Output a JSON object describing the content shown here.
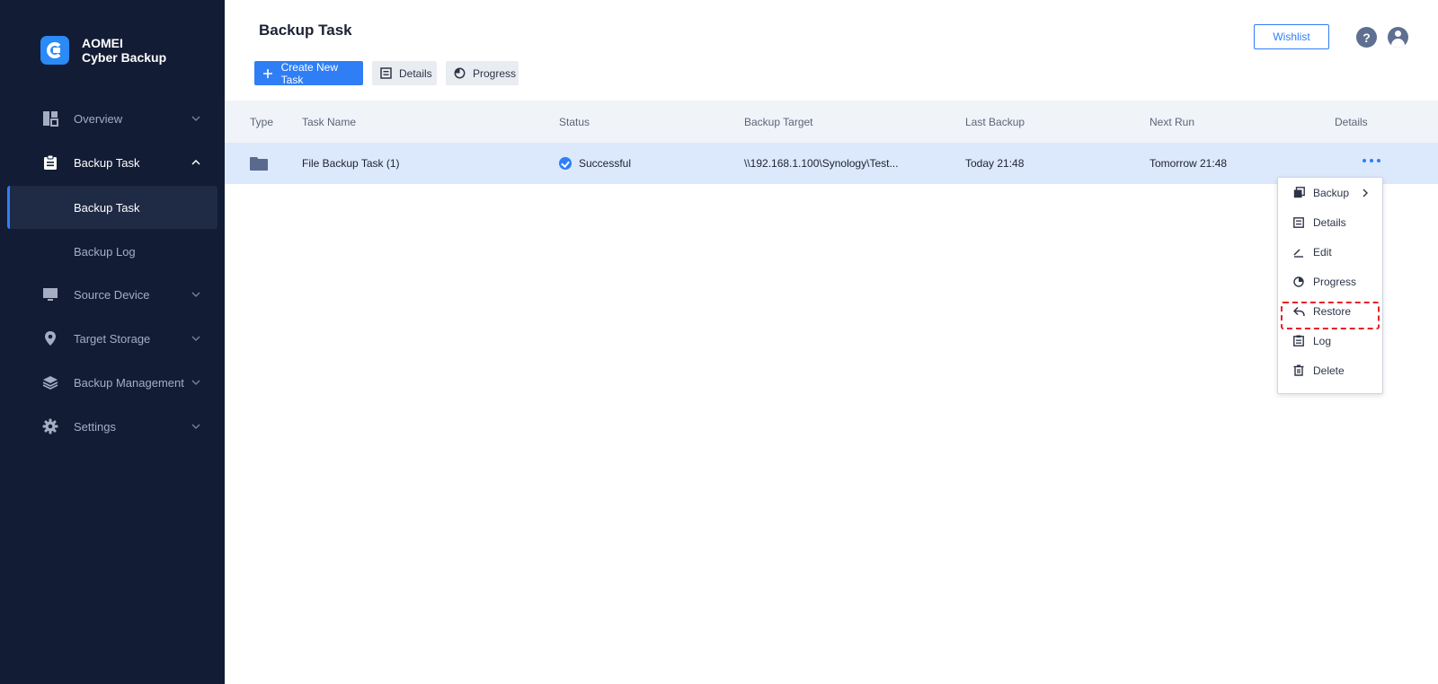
{
  "brand": {
    "line1": "AOMEI",
    "line2": "Cyber Backup",
    "accent": "#2f7ef5",
    "sidebar_bg": "#131c35"
  },
  "sidebar": {
    "items": [
      {
        "label": "Overview",
        "icon": "dashboard-icon"
      },
      {
        "label": "Backup Task",
        "icon": "clipboard-icon"
      },
      {
        "label": "Source Device",
        "icon": "monitor-icon"
      },
      {
        "label": "Target Storage",
        "icon": "location-pin-icon"
      },
      {
        "label": "Backup Management",
        "icon": "layers-icon"
      },
      {
        "label": "Settings",
        "icon": "gear-icon"
      }
    ],
    "subitems": [
      {
        "label": "Backup Task"
      },
      {
        "label": "Backup Log"
      }
    ]
  },
  "header": {
    "title": "Backup Task",
    "wishlist_label": "Wishlist",
    "help_label": "?"
  },
  "toolbar": {
    "create_label": "Create New Task",
    "details_label": "Details",
    "progress_label": "Progress"
  },
  "table": {
    "columns": [
      "Type",
      "Task Name",
      "Status",
      "Backup Target",
      "Last Backup",
      "Next Run",
      "Details"
    ],
    "rows": [
      {
        "type_icon": "folder-icon",
        "task_name": "File Backup Task (1)",
        "status": "Successful",
        "backup_target": "\\\\192.168.1.100\\Synology\\Test...",
        "last_backup": "Today 21:48",
        "next_run": "Tomorrow 21:48"
      }
    ]
  },
  "context_menu": {
    "items": [
      {
        "label": "Backup",
        "icon": "copy-icon"
      },
      {
        "label": "Details",
        "icon": "details-icon"
      },
      {
        "label": "Edit",
        "icon": "edit-icon"
      },
      {
        "label": "Progress",
        "icon": "progress-icon"
      },
      {
        "label": "Restore",
        "icon": "restore-icon"
      },
      {
        "label": "Log",
        "icon": "log-icon"
      },
      {
        "label": "Delete",
        "icon": "trash-icon"
      }
    ],
    "highlight_color": "#e8202a"
  }
}
